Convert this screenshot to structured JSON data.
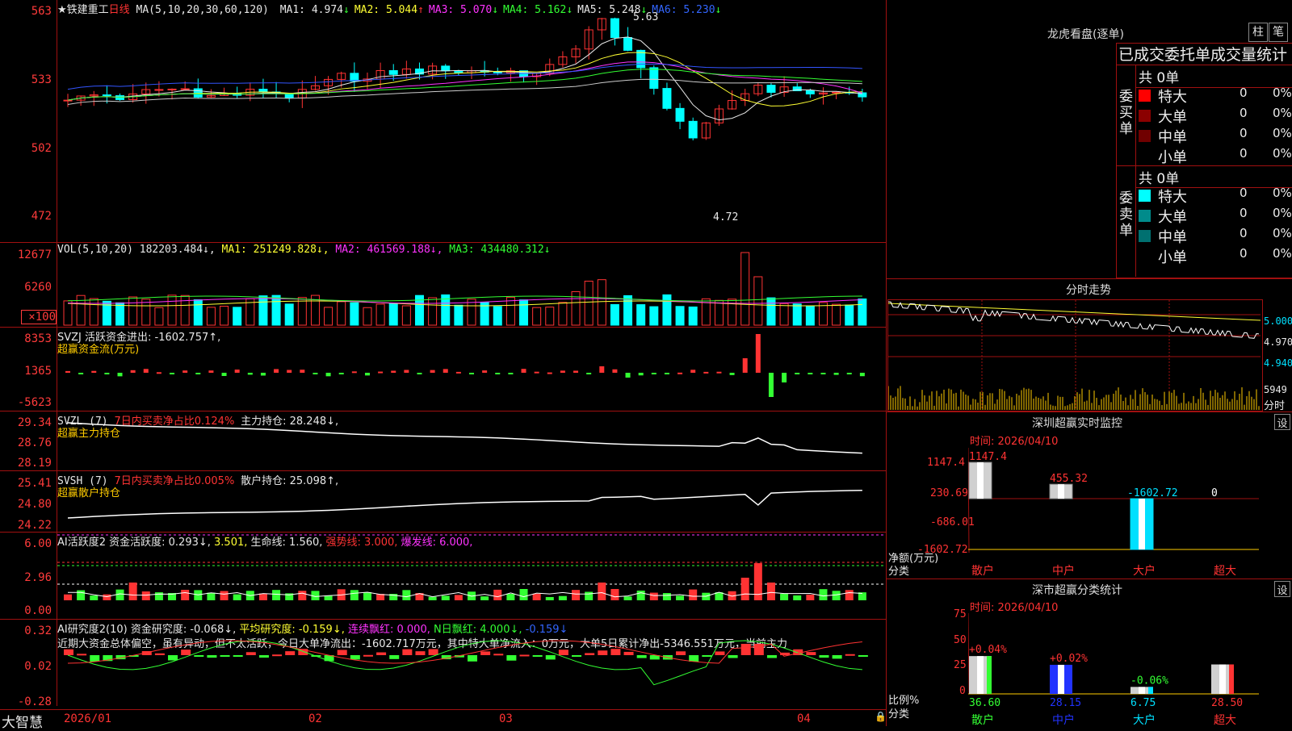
{
  "stock": {
    "name": "★铁建重工",
    "period": "日线"
  },
  "ma_header": {
    "label": "MA(5,10,20,30,60,120)",
    "items": [
      {
        "k": "MA1:",
        "v": "4.974",
        "arrow": "↓",
        "color": "#e8e8e8"
      },
      {
        "k": "MA2:",
        "v": "5.044",
        "arrow": "↑",
        "color": "#ffff33"
      },
      {
        "k": "MA3:",
        "v": "5.070",
        "arrow": "↓",
        "color": "#ff33ff"
      },
      {
        "k": "MA4:",
        "v": "5.162",
        "arrow": "↓",
        "color": "#33ff33"
      },
      {
        "k": "MA5:",
        "v": "5.248",
        "arrow": "↓",
        "color": "#e8e8e8"
      },
      {
        "k": "MA6:",
        "v": "5.230",
        "arrow": "↓",
        "color": "#3366ff"
      }
    ]
  },
  "price_axis": [
    "563",
    "533",
    "502",
    "472"
  ],
  "price_high_label": "5.63",
  "price_low_label": "4.72",
  "vol_header": {
    "label": "VOL(5,10,20)",
    "val": "182203.484↓,",
    "ma1": "MA1: 251249.828↓,",
    "ma2": "MA2: 461569.188↓,",
    "ma3": "MA3: 434480.312↓"
  },
  "vol_axis": [
    "12677",
    "6260",
    "×100"
  ],
  "svzj": {
    "line1": "SVZJ  活跃资金进出: -1602.757↑,",
    "line2": "超赢资金流(万元)",
    "axis": [
      "8353",
      "1365",
      "-5623"
    ]
  },
  "svzl": {
    "line1a": "SVZL (7)",
    "line1b": "7日内买卖净占比0.124%",
    "line1c": "主力持仓: 28.248↓,",
    "line2": "超赢主力持仓",
    "axis": [
      "29.34",
      "28.76",
      "28.19"
    ]
  },
  "svsh": {
    "line1a": "SVSH (7)",
    "line1b": "7日内买卖净占比0.005%",
    "line1c": "散户持仓: 25.098↑,",
    "line2": "超赢散户持仓",
    "axis": [
      "25.41",
      "24.80",
      "24.22"
    ]
  },
  "ai1": {
    "a": "AI活跃度2 资金活跃度: 0.293↓,",
    "b": "3.501,",
    "c": "生命线: 1.560,",
    "d": "强势线: 3.000,",
    "e": "爆发线: 6.000,",
    "axis": [
      "6.00",
      "2.96",
      "0.00"
    ]
  },
  "ai2": {
    "a": "AI研究度2(10) 资金研究度: -0.068↓,",
    "b": "平均研究度: -0.159↓,",
    "c": "连续飘红: 0.000,",
    "d": "N日飘红: 4.000↓,",
    "e": "-0.159↓",
    "text": "近期大资金总体偏空，虽有异动，但不太活跃，今日大单净流出：-1602.717万元，其中特大单净流入：0万元，大单5日累计净出-5346.551万元，当前主力",
    "axis": [
      "0.32",
      "0.02",
      "-0.28"
    ]
  },
  "date_axis": [
    "2026/01",
    "02",
    "03",
    "04"
  ],
  "brand": "大智慧",
  "right": {
    "top_title": "龙虎看盘(逐单)",
    "btn_bar": "柱",
    "btn_pen": "笔",
    "stats_title": "已成交委托单成交量统计",
    "buy": {
      "side": "委买单",
      "total": "共 0单",
      "rows": [
        {
          "name": "特大",
          "v": "0",
          "p": "0%",
          "color": "#ff0000"
        },
        {
          "name": "大单",
          "v": "0",
          "p": "0%",
          "color": "#8b0000"
        },
        {
          "name": "中单",
          "v": "0",
          "p": "0%",
          "color": "#700000"
        },
        {
          "name": "小单",
          "v": "0",
          "p": "0%",
          "color": "#000000"
        }
      ]
    },
    "sell": {
      "side": "委卖单",
      "total": "共 0单",
      "rows": [
        {
          "name": "特大",
          "v": "0",
          "p": "0%",
          "color": "#00ffff"
        },
        {
          "name": "大单",
          "v": "0",
          "p": "0%",
          "color": "#008b8b"
        },
        {
          "name": "中单",
          "v": "0",
          "p": "0%",
          "color": "#007070"
        },
        {
          "name": "小单",
          "v": "0",
          "p": "0%",
          "color": "#000000"
        }
      ]
    },
    "intraday": {
      "title": "分时走势",
      "axis": [
        "5.000",
        "4.970",
        "4.940",
        "5949"
      ],
      "unit": "分时"
    },
    "monitor": {
      "title": "深圳超赢实时监控",
      "set": "设",
      "time": "时间: 2026/04/10",
      "axis": [
        "1147.4",
        "230.69",
        "-686.01",
        "-1602.72"
      ],
      "labels": [
        "1147.4",
        "455.32",
        "-1602.72",
        "0"
      ],
      "cats": [
        "散户",
        "中户",
        "大户",
        "超大"
      ],
      "values": [
        1147.4,
        455.32,
        -1602.72,
        0
      ],
      "ylabel1": "净额(万元)",
      "ylabel2": "分类"
    },
    "classify": {
      "title": "深市超赢分类统计",
      "set": "设",
      "time": "时间: 2026/04/10",
      "axis": [
        "75",
        "50",
        "25",
        "0"
      ],
      "top_labels": [
        "+0.04%",
        "+0.02%",
        "-0.06%",
        ""
      ],
      "bottom_labels": [
        "36.60",
        "28.15",
        "6.75",
        "28.50"
      ],
      "cats": [
        "散户",
        "中户",
        "大户",
        "超大"
      ],
      "values": [
        36.6,
        28.15,
        6.75,
        28.5
      ],
      "ylabel1": "比例%",
      "ylabel2": "分类"
    }
  },
  "colors": {
    "up": "#ff3333",
    "down": "#00ffff",
    "grid": "#a01010"
  }
}
